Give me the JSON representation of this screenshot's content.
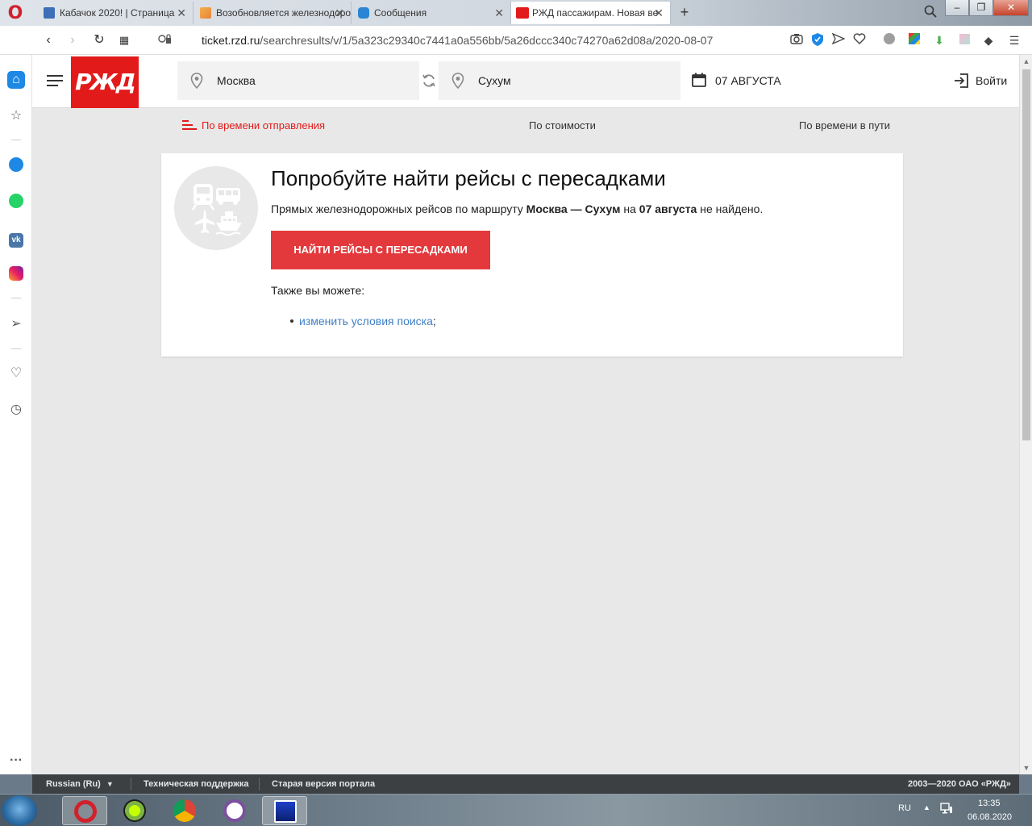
{
  "browser": {
    "tabs": [
      {
        "title": "Кабачок 2020! | Страница",
        "icon_color": "#3b6fb6",
        "active": false
      },
      {
        "title": "Возобновляется железнодорожное",
        "icon_color": "#e8833a",
        "active": false
      },
      {
        "title": "Сообщения",
        "icon_color": "#2a86d4",
        "active": false
      },
      {
        "title": "РЖД пассажирам. Новая ве",
        "icon_color": "#e21a1a",
        "active": true
      }
    ],
    "url": {
      "host": "ticket.rzd.ru",
      "path": "/searchresults/v/1/5a323c29340c7441a0a556bb/5a26dccc340c74270a62d08a/2020-08-07"
    }
  },
  "site": {
    "logo_text": "РЖД",
    "from_city": "Москва",
    "to_city": "Сухум",
    "date": "07 АВГУСТА",
    "login": "Войти",
    "brand_color": "#e21a1a"
  },
  "sort": {
    "by_departure": "По времени отправления",
    "by_price": "По стоимости",
    "by_duration": "По времени в пути"
  },
  "result": {
    "title": "Попробуйте найти рейсы с пересадками",
    "desc_prefix": "Прямых железнодорожных рейсов по маршруту",
    "route": "Москва — Сухум",
    "desc_on": "на",
    "route_date": "07 августа",
    "desc_suffix": "не найдено.",
    "cta": "Найти рейсы с пересадками",
    "also": "Также вы можете:",
    "link": "изменить условия поиска",
    "link_suffix": ";"
  },
  "footer": {
    "language": "Russian (Ru)",
    "support": "Техническая поддержка",
    "old_version": "Старая версия портала",
    "copyright": "2003—2020 ОАО «РЖД»"
  },
  "taskbar": {
    "lang": "RU",
    "time": "13:35",
    "date": "06.08.2020"
  }
}
